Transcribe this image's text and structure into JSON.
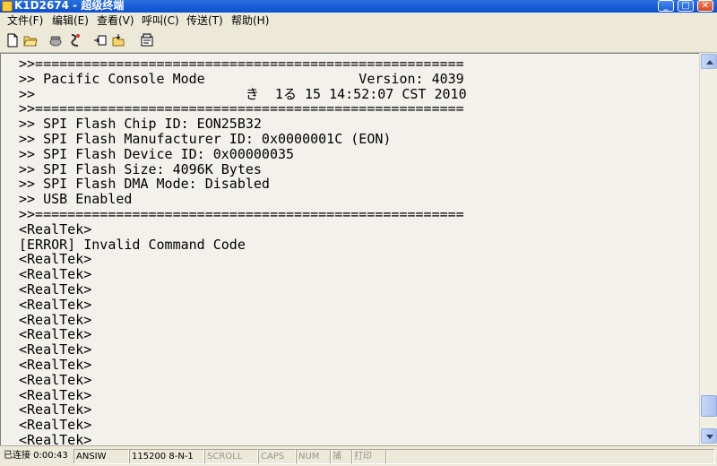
{
  "window": {
    "title": "K1D2674 - 超级终端"
  },
  "menu": [
    {
      "label": "文件(F)"
    },
    {
      "label": "编辑(E)"
    },
    {
      "label": "查看(V)"
    },
    {
      "label": "呼叫(C)"
    },
    {
      "label": "传送(T)"
    },
    {
      "label": "帮助(H)"
    }
  ],
  "toolbar": [
    {
      "icon": "new-document-icon"
    },
    {
      "icon": "open-folder-icon"
    },
    {
      "icon": "phone-icon"
    },
    {
      "icon": "disconnect-icon"
    },
    {
      "icon": "send-icon"
    },
    {
      "icon": "receive-icon"
    },
    {
      "icon": "properties-icon"
    }
  ],
  "terminal": {
    "lines": [
      ">>=====================================================",
      ">> Pacific Console Mode                   Version: 4039",
      ">>                          き  1る 15 14:52:07 CST 2010",
      ">>=====================================================",
      ">> SPI Flash Chip ID: EON25B32",
      ">> SPI Flash Manufacturer ID: 0x0000001C (EON)",
      ">> SPI Flash Device ID: 0x00000035",
      ">> SPI Flash Size: 4096K Bytes",
      ">> SPI Flash DMA Mode: Disabled",
      ">> USB Enabled",
      ">>=====================================================",
      "<RealTek>",
      "[ERROR] Invalid Command Code",
      "<RealTek>",
      "<RealTek>",
      "<RealTek>",
      "<RealTek>",
      "<RealTek>",
      "<RealTek>",
      "<RealTek>",
      "<RealTek>",
      "<RealTek>",
      "<RealTek>",
      "<RealTek>",
      "<RealTek>",
      "<RealTek>"
    ]
  },
  "status": {
    "connected": "已连接 0:00:43",
    "emulation": "ANSIW",
    "port": "115200 8-N-1",
    "scroll": "SCROLL",
    "caps": "CAPS",
    "num": "NUM",
    "capture": "捕",
    "print": "打印"
  }
}
